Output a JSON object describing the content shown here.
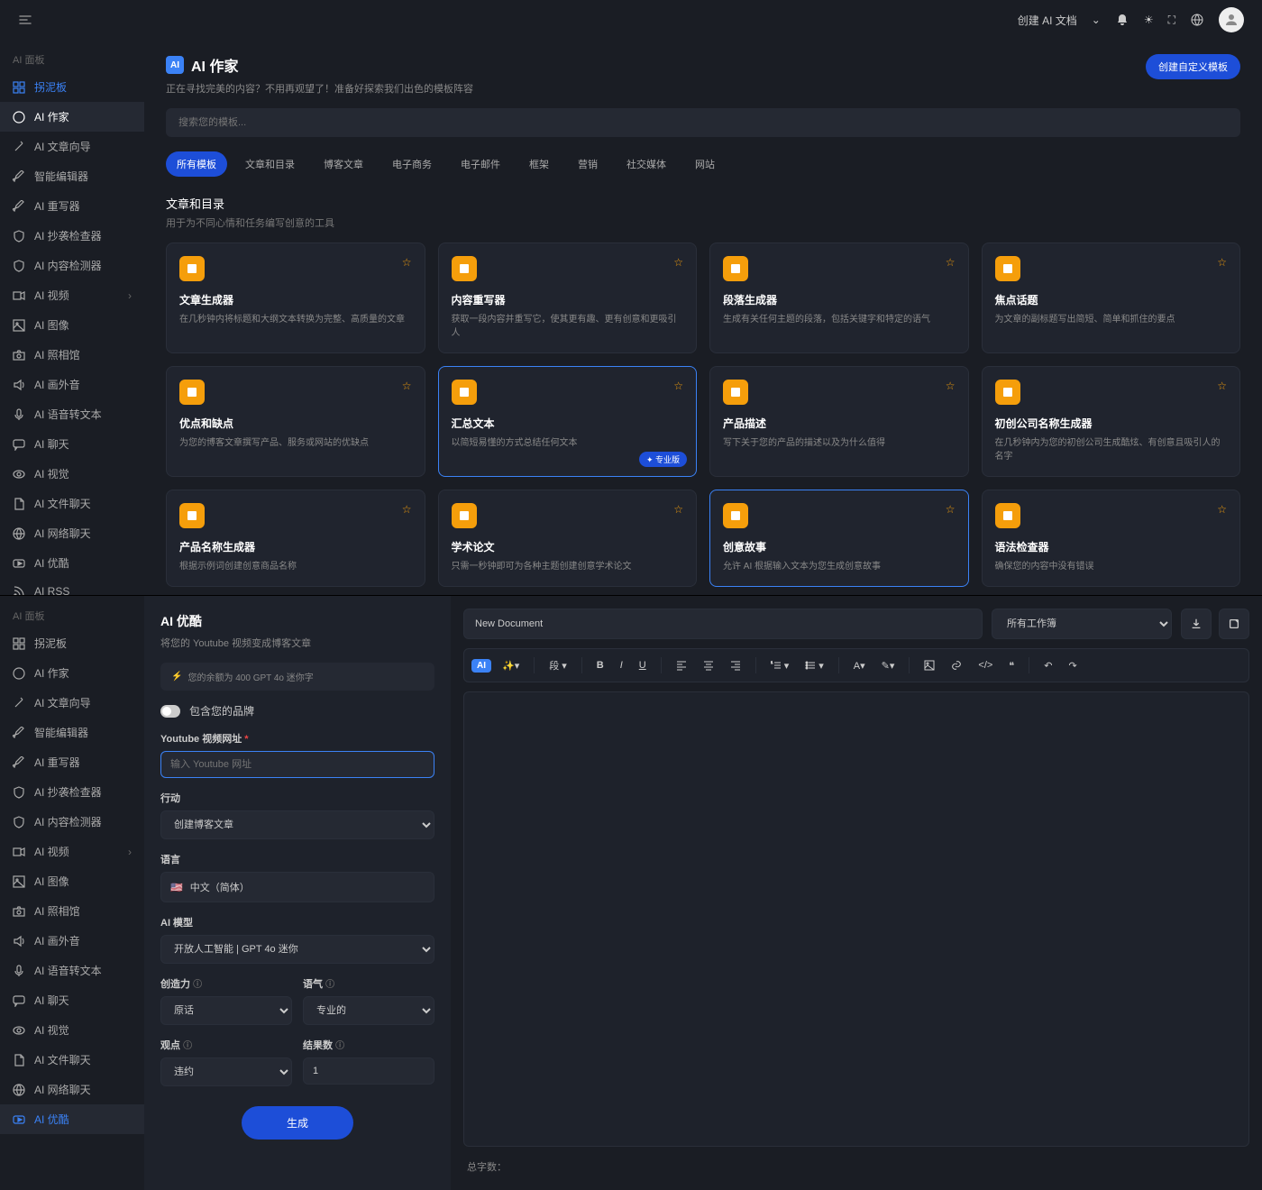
{
  "topbar": {
    "create": "创建 AI 文档"
  },
  "sidebar_header": "AI 面板",
  "sidebar1": [
    {
      "label": "拐泥板",
      "icon": "grid"
    },
    {
      "label": "AI 作家",
      "icon": "ai"
    },
    {
      "label": "AI 文章向导",
      "icon": "wand"
    },
    {
      "label": "智能编辑器",
      "icon": "pen"
    },
    {
      "label": "AI 重写器",
      "icon": "pen"
    },
    {
      "label": "AI 抄袭检查器",
      "icon": "shield"
    },
    {
      "label": "AI 内容检测器",
      "icon": "shield"
    },
    {
      "label": "AI 视频",
      "icon": "video",
      "chev": true
    },
    {
      "label": "AI 图像",
      "icon": "image"
    },
    {
      "label": "AI 照相馆",
      "icon": "camera"
    },
    {
      "label": "AI 画外音",
      "icon": "sound"
    },
    {
      "label": "AI 语音转文本",
      "icon": "mic"
    },
    {
      "label": "AI 聊天",
      "icon": "chat"
    },
    {
      "label": "AI 视觉",
      "icon": "eye"
    },
    {
      "label": "AI 文件聊天",
      "icon": "file"
    },
    {
      "label": "AI 网络聊天",
      "icon": "globe"
    },
    {
      "label": "AI 优酷",
      "icon": "play"
    },
    {
      "label": "AI RSS",
      "icon": "rss"
    }
  ],
  "sidebar2": [
    {
      "label": "拐泥板",
      "icon": "grid"
    },
    {
      "label": "AI 作家",
      "icon": "ai"
    },
    {
      "label": "AI 文章向导",
      "icon": "wand"
    },
    {
      "label": "智能编辑器",
      "icon": "pen"
    },
    {
      "label": "AI 重写器",
      "icon": "pen"
    },
    {
      "label": "AI 抄袭检查器",
      "icon": "shield"
    },
    {
      "label": "AI 内容检测器",
      "icon": "shield"
    },
    {
      "label": "AI 视频",
      "icon": "video",
      "chev": true
    },
    {
      "label": "AI 图像",
      "icon": "image"
    },
    {
      "label": "AI 照相馆",
      "icon": "camera"
    },
    {
      "label": "AI 画外音",
      "icon": "sound"
    },
    {
      "label": "AI 语音转文本",
      "icon": "mic"
    },
    {
      "label": "AI 聊天",
      "icon": "chat"
    },
    {
      "label": "AI 视觉",
      "icon": "eye"
    },
    {
      "label": "AI 文件聊天",
      "icon": "file"
    },
    {
      "label": "AI 网络聊天",
      "icon": "globe"
    },
    {
      "label": "AI 优酷",
      "icon": "play"
    }
  ],
  "page": {
    "title": "AI 作家",
    "subtitle": "正在寻找完美的内容？不用再观望了！准备好探索我们出色的模板阵容",
    "create_btn": "创建自定义模板",
    "search_placeholder": "搜索您的模板..."
  },
  "tabs": [
    "所有模板",
    "文章和目录",
    "博客文章",
    "电子商务",
    "电子邮件",
    "框架",
    "营销",
    "社交媒体",
    "网站"
  ],
  "section": {
    "title": "文章和目录",
    "sub": "用于为不同心情和任务编写创意的工具"
  },
  "cards": [
    {
      "title": "文章生成器",
      "desc": "在几秒钟内将标题和大纲文本转换为完整、高质量的文章"
    },
    {
      "title": "内容重写器",
      "desc": "获取一段内容并重写它，使其更有趣、更有创意和更吸引人"
    },
    {
      "title": "段落生成器",
      "desc": "生成有关任何主题的段落，包括关键字和特定的语气"
    },
    {
      "title": "焦点话题",
      "desc": "为文章的副标题写出简短、简单和抓住的要点"
    },
    {
      "title": "优点和缺点",
      "desc": "为您的博客文章撰写产品、服务或网站的优缺点"
    },
    {
      "title": "汇总文本",
      "desc": "以简短易懂的方式总结任何文本",
      "selected": true,
      "badge": "✦ 专业版"
    },
    {
      "title": "产品描述",
      "desc": "写下关于您的产品的描述以及为什么值得"
    },
    {
      "title": "初创公司名称生成器",
      "desc": "在几秒钟内为您的初创公司生成酷炫、有创意且吸引人的名字"
    },
    {
      "title": "产品名称生成器",
      "desc": "根据示例词创建创意商品名称"
    },
    {
      "title": "学术论文",
      "desc": "只需一秒钟即可为各种主题创建创意学术论文"
    },
    {
      "title": "创意故事",
      "desc": "允许 AI 根据输入文本为您生成创意故事",
      "selected": true
    },
    {
      "title": "语法检查器",
      "desc": "确保您的内容中没有错误"
    }
  ],
  "form": {
    "title": "AI 优酷",
    "sub": "将您的 Youtube 视频变成博客文章",
    "credits": "您的余额为 400 GPT 4o 迷你字",
    "brand_toggle": "包含您的品牌",
    "url_label": "Youtube 视频网址",
    "url_placeholder": "输入 Youtube 网址",
    "action_label": "行动",
    "action_value": "创建博客文章",
    "lang_label": "语言",
    "lang_value": "中文（简体）",
    "model_label": "AI 模型",
    "model_value": "开放人工智能 | GPT 4o 迷你",
    "creativity_label": "创造力",
    "creativity_value": "原话",
    "help": "?",
    "tone_label": "语气",
    "tone_value": "专业的",
    "view_label": "观点",
    "view_value": "违约",
    "results_label": "结果数",
    "results_value": "1",
    "generate": "生成"
  },
  "editor": {
    "doc_name": "New Document",
    "workspace": "所有工作簿",
    "para": "段",
    "footer": "总字数："
  }
}
